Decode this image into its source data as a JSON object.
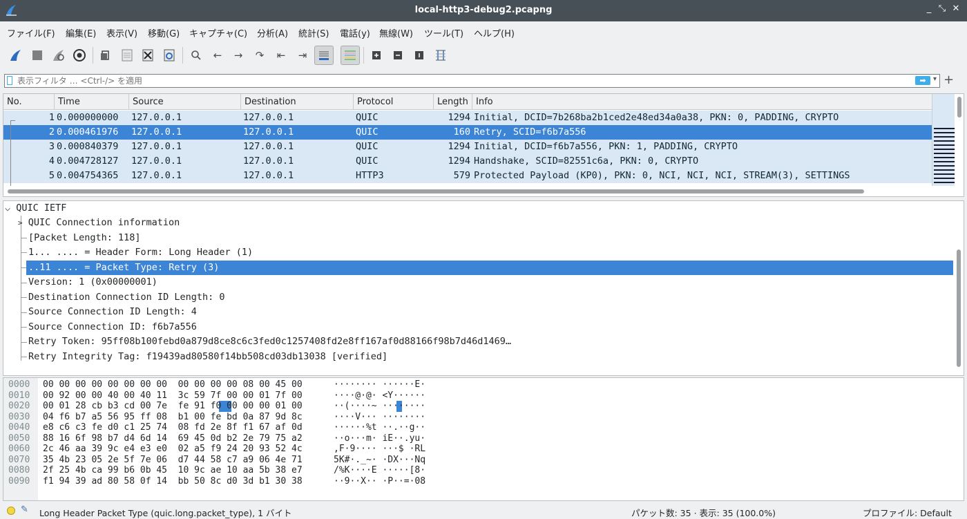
{
  "window": {
    "title": "local-http3-debug2.pcapng",
    "controls": [
      "_",
      "⤡",
      "✕"
    ]
  },
  "menu": [
    "ファイル(F)",
    "編集(E)",
    "表示(V)",
    "移動(G)",
    "キャプチャ(C)",
    "分析(A)",
    "統計(S)",
    "電話(y)",
    "無線(W)",
    "ツール(T)",
    "ヘルプ(H)"
  ],
  "toolbar": {
    "icons": [
      "shark-fin-start-icon",
      "stop-icon",
      "restart-icon",
      "capture-options-icon",
      "open-file-icon",
      "save-file-icon",
      "close-file-icon",
      "reload-file-icon",
      "find-packet-icon",
      "go-back-icon",
      "go-forward-icon",
      "go-to-packet-icon",
      "go-first-icon",
      "go-last-icon",
      "auto-scroll-icon",
      "colorize-icon",
      "zoom-in-icon",
      "zoom-out-icon",
      "normal-size-icon",
      "resize-columns-icon"
    ]
  },
  "filter": {
    "placeholder": "表示フィルタ … <Ctrl-/> を適用",
    "value": ""
  },
  "packet_list": {
    "columns": [
      "No.",
      "Time",
      "Source",
      "Destination",
      "Protocol",
      "Length",
      "Info"
    ],
    "rows": [
      {
        "no": "1",
        "time": "0.000000000",
        "src": "127.0.0.1",
        "dst": "127.0.0.1",
        "proto": "QUIC",
        "len": "1294",
        "info": "Initial, DCID=7b268ba2b1ced2e48ed34a0a38, PKN: 0, PADDING, CRYPTO"
      },
      {
        "no": "2",
        "time": "0.000461976",
        "src": "127.0.0.1",
        "dst": "127.0.0.1",
        "proto": "QUIC",
        "len": "160",
        "info": "Retry, SCID=f6b7a556"
      },
      {
        "no": "3",
        "time": "0.000840379",
        "src": "127.0.0.1",
        "dst": "127.0.0.1",
        "proto": "QUIC",
        "len": "1294",
        "info": "Initial, DCID=f6b7a556, PKN: 1, PADDING, CRYPTO"
      },
      {
        "no": "4",
        "time": "0.004728127",
        "src": "127.0.0.1",
        "dst": "127.0.0.1",
        "proto": "QUIC",
        "len": "1294",
        "info": "Handshake, SCID=82551c6a, PKN: 0, CRYPTO"
      },
      {
        "no": "5",
        "time": "0.004754365",
        "src": "127.0.0.1",
        "dst": "127.0.0.1",
        "proto": "HTTP3",
        "len": "579",
        "info": "Protected Payload (KP0), PKN: 0, NCI, NCI, NCI, STREAM(3), SETTINGS"
      }
    ],
    "selected_row": 2
  },
  "details": {
    "root": "QUIC IETF",
    "lines": [
      "QUIC Connection information",
      "[Packet Length: 118]",
      "1... .... = Header Form: Long Header (1)",
      "..11 .... = Packet Type: Retry (3)",
      "Version: 1 (0x00000001)",
      "Destination Connection ID Length: 0",
      "Source Connection ID Length: 4",
      "Source Connection ID: f6b7a556",
      "Retry Token: 95ff08b100febd0a879d8ce8c6c3fed0c1257408fd2e8ff167af0d88166f98b7d46d1469…",
      "Retry Integrity Tag: f19439ad80580f14bb508cd03db13038 [verified]"
    ],
    "selected_line": "..11 .... = Packet Type: Retry (3)"
  },
  "bytes": {
    "offsets": [
      "0000",
      "0010",
      "0020",
      "0030",
      "0040",
      "0050",
      "0060",
      "0070",
      "0080",
      "0090"
    ],
    "hex": [
      "00 00 00 00 00 00 00 00  00 00 00 00 08 00 45 00",
      "00 92 00 00 40 00 40 11  3c 59 7f 00 00 01 7f 00",
      "00 01 28 cb b3 cd 00 7e  fe 91 f0 00 00 00 01 00",
      "04 f6 b7 a5 56 95 ff 08  b1 00 fe bd 0a 87 9d 8c",
      "e8 c6 c3 fe d0 c1 25 74  08 fd 2e 8f f1 67 af 0d",
      "88 16 6f 98 b7 d4 6d 14  69 45 0d b2 2e 79 75 a2",
      "2c 46 aa 39 9c e4 e3 e0  02 a5 f9 24 20 93 52 4c",
      "35 4b 23 05 2e 5f 7e 06  d7 44 58 c7 a9 06 4e 71",
      "2f 25 4b ca 99 b6 0b 45  10 9c ae 10 aa 5b 38 e7",
      "f1 94 39 ad 80 58 0f 14  bb 50 8c d0 3d b1 30 38"
    ],
    "ascii": [
      "········ ······E·",
      "····@·@· <Y······",
      "··(····~ ········",
      "····V··· ········",
      "······%t ··.··g··",
      "··o···m· iE··.yu·",
      ",F·9···· ···$ ·RL",
      "5K#·._~· ·DX···Nq",
      "/%K····E ·····[8·",
      "··9··X·· ·P··=·08"
    ]
  },
  "status": {
    "field": "Long Header Packet Type (quic.long.packet_type), 1 バイト",
    "packets": "パケット数: 35 · 表示: 35 (100.0%)",
    "profile": "プロファイル: Default"
  }
}
